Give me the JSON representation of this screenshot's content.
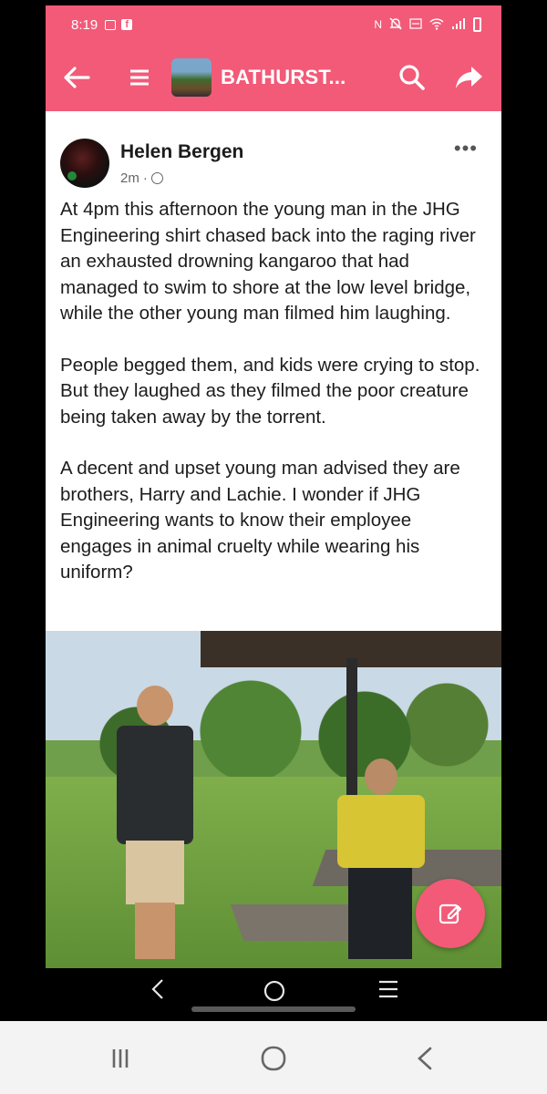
{
  "status_bar": {
    "time": "8:19",
    "left_icons": [
      "gallery-icon",
      "facebook-icon"
    ],
    "right_icons": [
      "nfc-icon",
      "mute-icon",
      "volte-icon",
      "wifi-icon",
      "signal-icon",
      "battery-icon"
    ],
    "right_text": "N"
  },
  "app_bar": {
    "title": "BATHURST...",
    "icons": [
      "back-arrow-icon",
      "menu-icon",
      "group-thumbnail",
      "search-icon",
      "share-icon"
    ]
  },
  "post": {
    "author": "Helen Bergen",
    "timestamp": "2m",
    "separator": "·",
    "more_label": "•••",
    "paragraphs": [
      "At 4pm this afternoon the young man in the JHG Engineering shirt chased back into the raging river an exhausted drowning kangaroo that had managed to swim to shore at the low level bridge, while the other young man filmed him laughing.",
      "People begged them, and kids were crying to stop. But they laughed as they filmed  the poor creature being taken away by the torrent.",
      "A decent and upset young man advised they are brothers, Harry and Lachie. I wonder if JHG Engineering wants to know their employee engages in animal cruelty while wearing his uniform?"
    ]
  },
  "colors": {
    "accent": "#f25a78",
    "text": "#1c1c1c"
  },
  "nav": {
    "inner": [
      "back-icon",
      "home-icon",
      "recents-icon"
    ],
    "system": [
      "recents-icon",
      "home-icon",
      "back-icon"
    ]
  }
}
